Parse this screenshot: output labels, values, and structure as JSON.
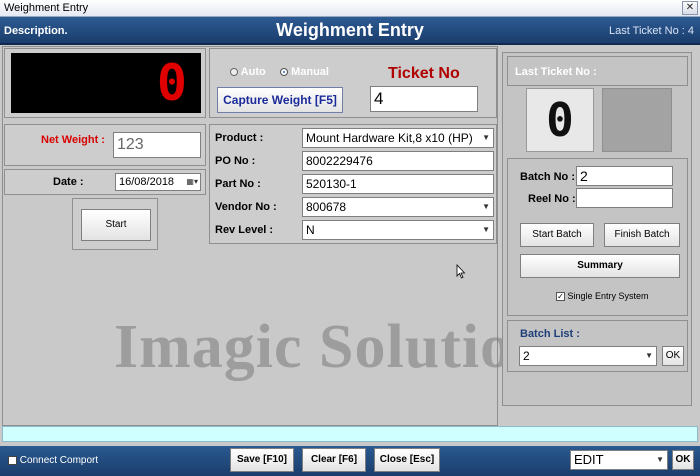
{
  "window": {
    "title": "Weighment Entry",
    "close_glyph": "✕"
  },
  "header": {
    "description": "Description.",
    "title": "Weighment Entry",
    "last_ticket": "Last Ticket No :  4"
  },
  "weight_display": {
    "value": "0"
  },
  "mode": {
    "auto_label": "Auto",
    "manual_label": "Manual",
    "selected": "Manual"
  },
  "capture_button": "Capture Weight [F5]",
  "ticket": {
    "label": "Ticket No",
    "value": "4"
  },
  "net_weight": {
    "label": "Net Weight :",
    "value": "123"
  },
  "date": {
    "label": "Date :",
    "value": "16/08/2018"
  },
  "start_button": "Start",
  "fields": {
    "product": {
      "label": "Product :",
      "value": "Mount Hardware Kit,8 x10  (HP)"
    },
    "po": {
      "label": "PO No :",
      "value": "8002229476"
    },
    "part": {
      "label": "Part No :",
      "value": "520130-1"
    },
    "vendor": {
      "label": "Vendor No :",
      "value": "800678"
    },
    "rev": {
      "label": "Rev Level :",
      "value": "N"
    }
  },
  "right_panel": {
    "header": "Last Ticket No :",
    "display_value": "0",
    "batch_label": "Batch No :",
    "batch_value": "2",
    "reel_label": "Reel No :",
    "reel_value": "",
    "start_batch": "Start Batch",
    "finish_batch": "Finish Batch",
    "summary": "Summary",
    "single_entry": "Single Entry System",
    "single_entry_checked": true,
    "batch_list_label": "Batch List :",
    "batch_list_value": "2",
    "ok": "OK"
  },
  "watermark": "Imagic Solution",
  "footer": {
    "connect_comport": "Connect Comport",
    "save": "Save [F10]",
    "clear": "Clear [F6]",
    "close": "Close [Esc]",
    "mode_value": "EDIT",
    "ok": "OK"
  },
  "colors": {
    "header_blue": "#1f477a",
    "ticket_red": "#b00000",
    "netweight_red": "#d80000",
    "status_cyan": "#cfffff"
  }
}
